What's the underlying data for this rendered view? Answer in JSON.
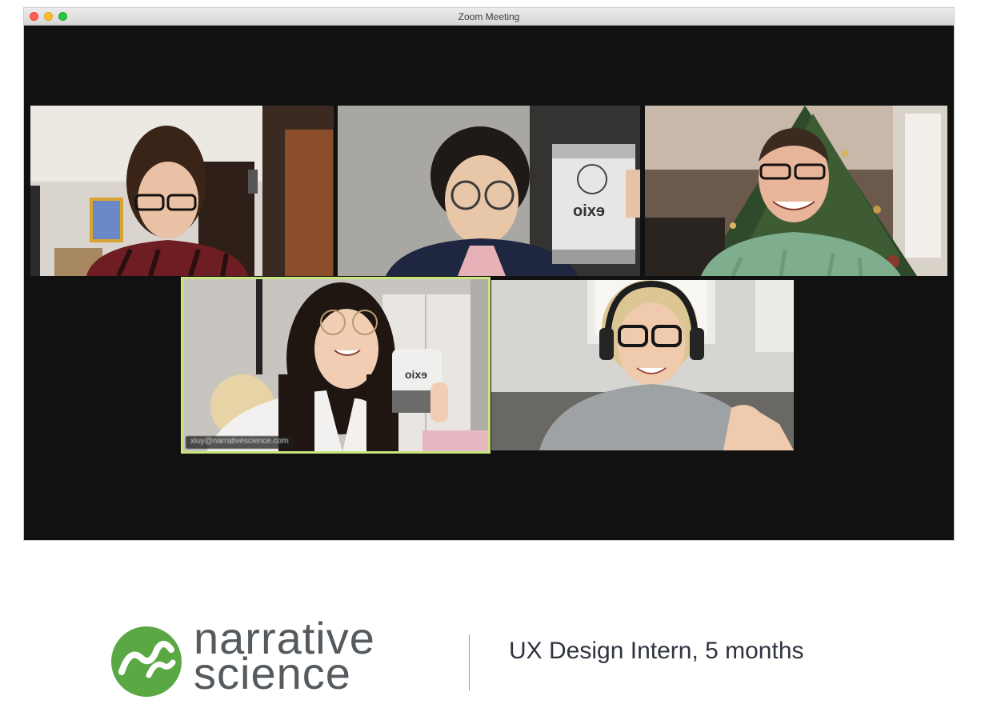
{
  "window": {
    "title": "Zoom Meeting",
    "controls": [
      "close",
      "minimize",
      "maximize"
    ]
  },
  "participants": [
    {
      "id": "p1",
      "description": "video-tile"
    },
    {
      "id": "p2",
      "description": "video-tile",
      "mug_text": "exio"
    },
    {
      "id": "p3",
      "description": "video-tile"
    },
    {
      "id": "p4",
      "description": "video-tile",
      "active_speaker": true,
      "name_tag": "xiuy@narrativescience.com",
      "mug_text": "exio"
    },
    {
      "id": "p5",
      "description": "video-tile"
    }
  ],
  "footer": {
    "logo_line1": "narrative",
    "logo_line2": "science",
    "role": "UX Design Intern, 5 months"
  },
  "colors": {
    "meeting_bg": "#111111",
    "active_border": "#c9e57c",
    "logo_green": "#5aa844",
    "logo_gray": "#555a5f"
  }
}
